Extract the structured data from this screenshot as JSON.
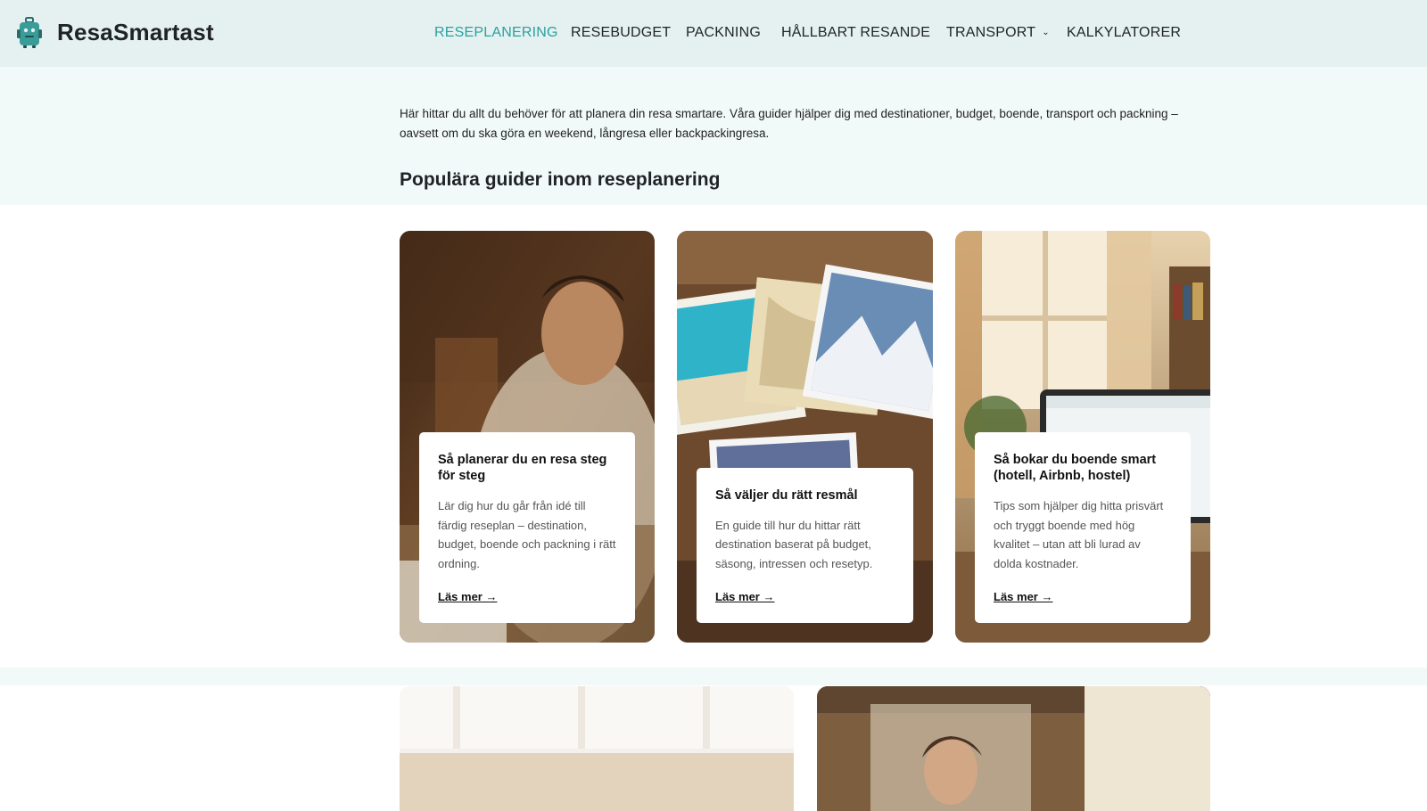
{
  "brand": {
    "name": "ResaSmartast",
    "logo_icon": "suitcase-robot-icon"
  },
  "nav": {
    "items": [
      {
        "label": "RESEPLANERING",
        "active": true
      },
      {
        "label": "RESEBUDGET",
        "active": false
      },
      {
        "label": "PACKNING",
        "active": false
      },
      {
        "label": "HÅLLBART RESANDE",
        "active": false
      },
      {
        "label": "TRANSPORT",
        "active": false,
        "has_dropdown": true
      },
      {
        "label": "KALKYLATORER",
        "active": false
      }
    ]
  },
  "intro": {
    "text": "Här hittar du allt du behöver för att planera din resa smartare. Våra guider hjälper dig med destinationer, budget, boende, transport och packning – oavsett om du ska göra en weekend, långresa eller backpackingresa."
  },
  "section": {
    "title": "Populära guider inom reseplanering"
  },
  "cards": [
    {
      "title": "Så planerar du en resa steg för steg",
      "text": "Lär dig hur du går från idé till färdig reseplan – destination, budget, boende och packning i rätt ordning.",
      "link": "Läs mer →"
    },
    {
      "title": "Så väljer du rätt resmål",
      "text": "En guide till hur du hittar rätt destination baserat på budget, säsong, intressen och resetyp.",
      "link": "Läs mer →"
    },
    {
      "title": "Så bokar du boende smart (hotell, Airbnb, hostel)",
      "text": "Tips som hjälper dig hitta prisvärt och tryggt boende med hög kvalitet – utan att bli lurad av dolda kostnader.",
      "link": "Läs mer →"
    }
  ],
  "colors": {
    "accent": "#2aa1a0",
    "header_bg": "#e4f1f0",
    "band_bg": "#f2f9f9",
    "text": "#1f2326"
  }
}
